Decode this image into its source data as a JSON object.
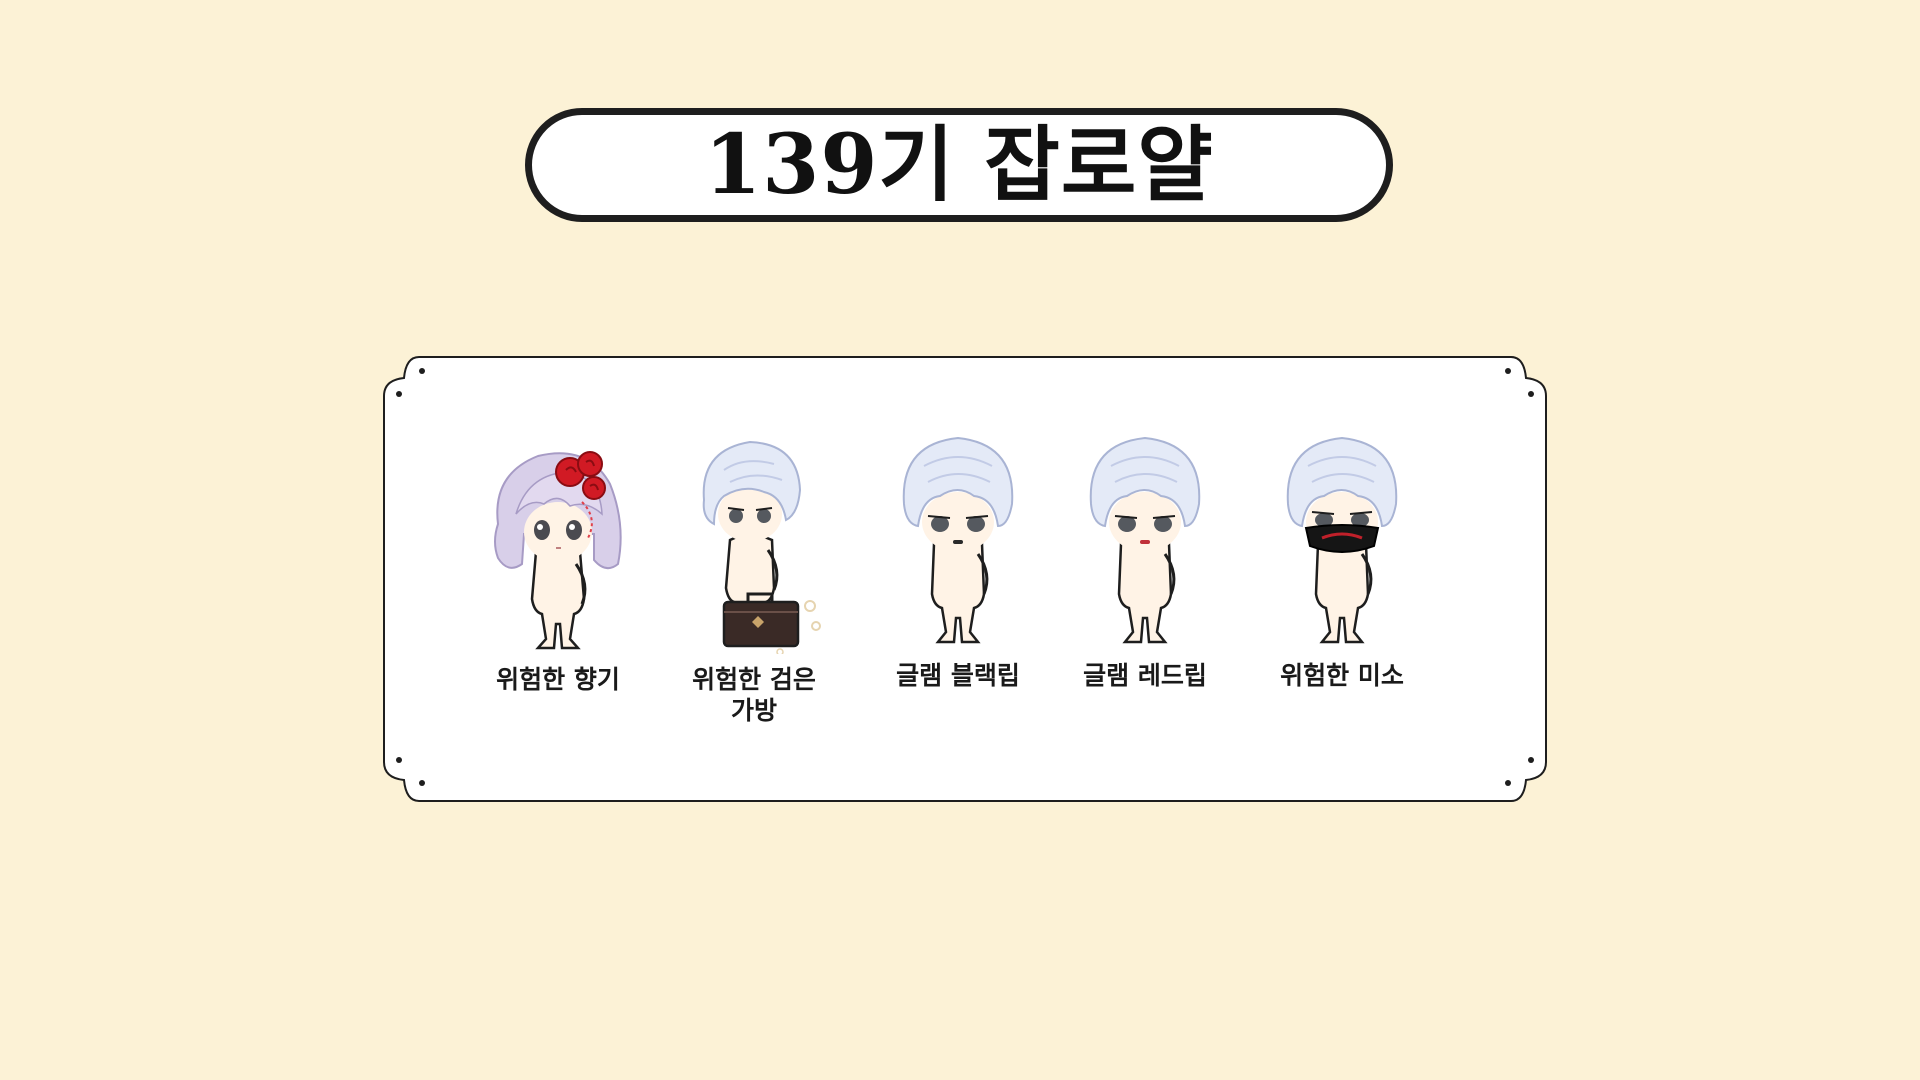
{
  "title": "139기 잡로얄",
  "colors": {
    "background": "#fcf2d6",
    "panel": "#ffffff",
    "outline": "#1e1e1e",
    "hair_white": "#e4eaf7",
    "hair_lavender": "#d8cfe9",
    "rose": "#d11a24",
    "skin": "#fff3e6"
  },
  "items": [
    {
      "label": "위험한 향기",
      "icon": "red-rose-hair-avatar"
    },
    {
      "label": "위험한 검은 가방",
      "icon": "black-bag-avatar"
    },
    {
      "label": "글램 블랙립",
      "icon": "black-lip-avatar"
    },
    {
      "label": "글램 레드립",
      "icon": "red-lip-avatar"
    },
    {
      "label": "위험한 미소",
      "icon": "black-mask-avatar"
    }
  ]
}
